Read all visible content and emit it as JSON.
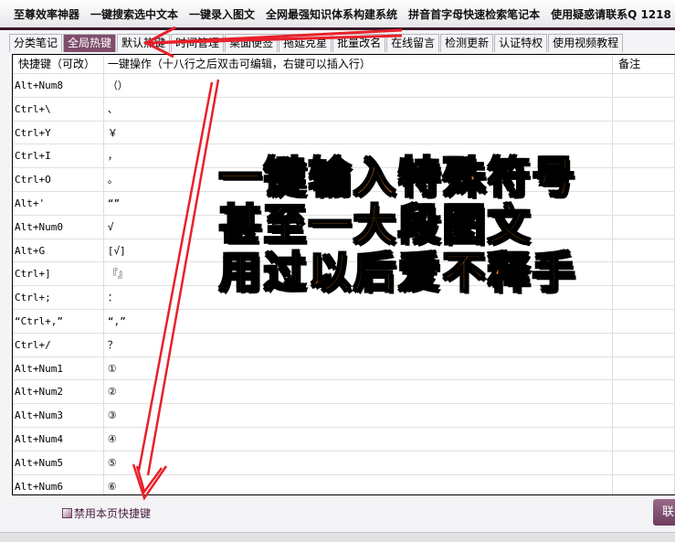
{
  "app": {
    "title": "至尊效率神器",
    "menu": [
      "一键搜索选中文本",
      "一键录入图文",
      "全网最强知识体系构建系统",
      "拼音首字母快速检索笔记本",
      "使用疑惑请联系Q 1218"
    ]
  },
  "tabs": [
    {
      "label": "分类笔记"
    },
    {
      "label": "全局热键",
      "active": true
    },
    {
      "label": "默认热键"
    },
    {
      "label": "时间管理"
    },
    {
      "label": "桌面便签"
    },
    {
      "label": "拖延克星"
    },
    {
      "label": "批量改名"
    },
    {
      "label": "在线留言"
    },
    {
      "label": "检测更新"
    },
    {
      "label": "认证特权"
    },
    {
      "label": "使用视频教程"
    }
  ],
  "table": {
    "headers": [
      "快捷键（可改）",
      "一键操作（十八行之后双击可编辑，右键可以插入行）",
      "备注"
    ],
    "rows": [
      [
        "Alt+Num8",
        "（）",
        ""
      ],
      [
        "Ctrl+\\",
        "、",
        ""
      ],
      [
        "Ctrl+Y",
        "￥",
        ""
      ],
      [
        "Ctrl+I",
        "，",
        ""
      ],
      [
        "Ctrl+O",
        "。",
        ""
      ],
      [
        "Alt+'",
        "“”",
        ""
      ],
      [
        "Alt+Num0",
        "√",
        ""
      ],
      [
        "Alt+G",
        "[√]",
        ""
      ],
      [
        "Ctrl+]",
        "『』",
        ""
      ],
      [
        "Ctrl+;",
        "：",
        ""
      ],
      [
        "“Ctrl+,”",
        "“,”",
        ""
      ],
      [
        "Ctrl+/",
        "？",
        ""
      ],
      [
        "Alt+Num1",
        "①",
        ""
      ],
      [
        "Alt+Num2",
        "②",
        ""
      ],
      [
        "Alt+Num3",
        "③",
        ""
      ],
      [
        "Alt+Num4",
        "④",
        ""
      ],
      [
        "Alt+Num5",
        "⑤",
        ""
      ],
      [
        "Alt+Num6",
        "⑥",
        ""
      ]
    ]
  },
  "bottom": {
    "disable_label": "禁用本页快捷键",
    "contact_label": "联"
  },
  "overlay": {
    "lines": [
      "一键输入特殊符号",
      "甚至一大段图文",
      "用过以后爱不释手"
    ]
  },
  "colors": {
    "accent": "#7e4d6c",
    "overlay_text": "#f7861e",
    "arrow": "#e8212b"
  }
}
